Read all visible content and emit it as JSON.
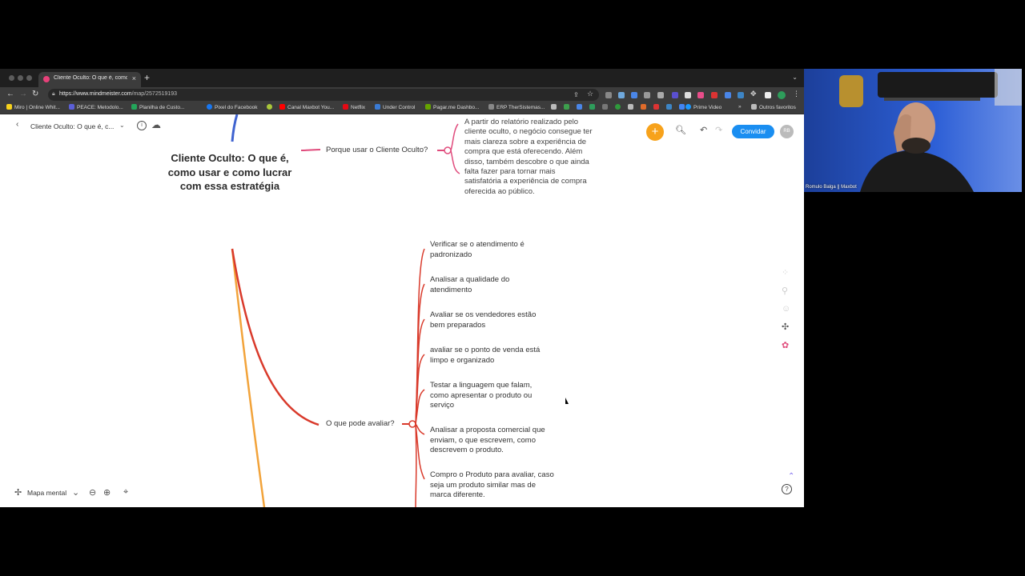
{
  "browser": {
    "tab_title": "Cliente Oculto: O que é, como",
    "tab_close": "×",
    "new_tab": "+",
    "url_host": "https://www.mindmeister.com",
    "url_path": "/map/2572519193",
    "bookmarks": [
      {
        "label": "Miro | Online Whit...",
        "color": "#f7d21c"
      },
      {
        "label": "PEACE: Metodolo...",
        "color": "#5b5fd8"
      },
      {
        "label": "Planilha de Custo...",
        "color": "#23a55a"
      },
      {
        "label": "Pixel do Facebook",
        "color": "#1877f2"
      },
      {
        "label": "Canal Maxbot You...",
        "color": "#ff0000"
      },
      {
        "label": "Netflix",
        "color": "#e50914"
      },
      {
        "label": "Under Control",
        "color": "#3a7bd5"
      },
      {
        "label": "Pagar.me Dashbo...",
        "color": "#65a300"
      },
      {
        "label": "ERP TherSistemas...",
        "color": "#888888"
      },
      {
        "label": "Prime Video",
        "color": "#1a98ff"
      }
    ],
    "other_bookmarks": "Outros favoritos",
    "more_bookmarks": "»"
  },
  "app": {
    "map_title": "Cliente Oculto: O que é, c...",
    "invite_label": "Convidar",
    "avatar_initials": "RB",
    "plus_label": "+",
    "map_type_label": "Mapa mental",
    "colors": {
      "accent": "#f7a21b",
      "invite": "#1a8ef1",
      "branch_red": "#d93a2b",
      "branch_pink": "#e04b7c",
      "branch_orange": "#f2a33a",
      "branch_blue": "#3f63d0"
    }
  },
  "mindmap": {
    "root": "Cliente Oculto: O que é, como usar e como lucrar com essa estratégia",
    "branch_why": "Porque usar o Cliente Oculto?",
    "why_note": "A partir do relatório realizado pelo cliente oculto, o negócio consegue ter mais clareza sobre a experiência de compra que está oferecendo. Além disso, também descobre o que ainda falta fazer para tornar mais satisfatória a experiência de compra oferecida ao público.",
    "branch_what": "O que pode avaliar?",
    "what_children": [
      "Verificar se o atendimento é padronizado",
      "Analisar a qualidade do atendimento",
      "Avaliar se os vendedores estão bem preparados",
      "avaliar se o ponto de venda está limpo e organizado",
      "Testar a linguagem que falam, como apresentar o produto ou serviço",
      "Analisar a proposta comercial que enviam, o que escrevem, como descrevem o produto.",
      "Compro o Produto para avaliar, caso seja um produto similar mas de marca diferente."
    ]
  },
  "webcam": {
    "label": "Romulo Balga || Maxbot"
  }
}
